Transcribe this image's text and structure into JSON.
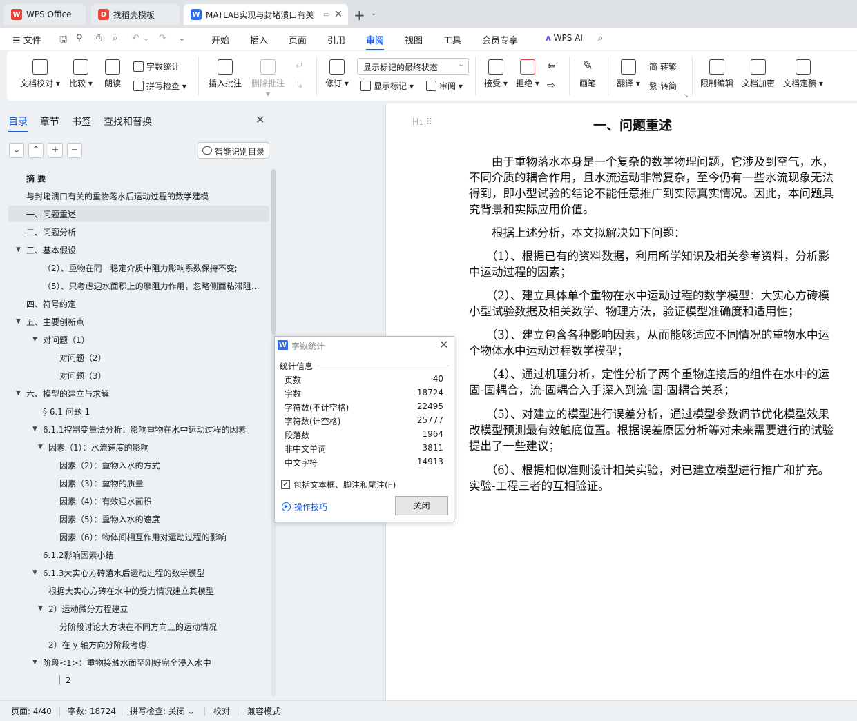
{
  "tabs": [
    {
      "label": "WPS Office",
      "logo": "W",
      "color": "#e8443a"
    },
    {
      "label": "找稻壳模板",
      "logo": "D",
      "color": "#e8443a"
    },
    {
      "label": "MATLAB实现与封堵溃口有关",
      "logo": "W",
      "color": "#2c6cf0"
    }
  ],
  "menu": {
    "file": "文件",
    "items": [
      "开始",
      "插入",
      "页面",
      "引用",
      "审阅",
      "视图",
      "工具",
      "会员专享"
    ],
    "active": "审阅",
    "wps_ai": "WPS AI"
  },
  "ribbon": {
    "doc_check": "文档校对",
    "compare": "比较",
    "read_aloud": "朗读",
    "word_count": "字数统计",
    "spell_check": "拼写检查",
    "insert_comment": "插入批注",
    "delete_comment": "删除批注",
    "revise": "修订",
    "markup_state": "显示标记的最终状态",
    "show_markup": "显示标记",
    "review": "审阅",
    "accept": "接受",
    "reject": "拒绝",
    "pen": "画笔",
    "translate": "翻译",
    "to_traditional": "转繁",
    "to_simplified": "转简",
    "restrict_edit": "限制编辑",
    "encrypt": "文档加密",
    "finalize": "文档定稿"
  },
  "nav": {
    "tabs": [
      "目录",
      "章节",
      "书签",
      "查找和替换"
    ],
    "active_tab": "目录",
    "smart_toc": "智能识别目录",
    "controls": [
      "⌄",
      "⌃",
      "+",
      "−"
    ],
    "items": [
      {
        "text": "摘  要",
        "indent": 0,
        "caret": "",
        "bold": true
      },
      {
        "text": "与封堵溃口有关的重物落水后运动过程的数学建模",
        "indent": 0,
        "caret": ""
      },
      {
        "text": "一、问题重述",
        "indent": 0,
        "caret": "",
        "selected": true
      },
      {
        "text": "二、问题分析",
        "indent": 0,
        "caret": ""
      },
      {
        "text": "三、基本假设",
        "indent": 0,
        "caret": "▼"
      },
      {
        "text": "（2）、重物在同一稳定介质中阻力影响系数保持不变;",
        "indent": 1,
        "caret": ""
      },
      {
        "text": "（5）、只考虑迎水面积上的摩阻力作用，忽略侧面粘滞阻力...",
        "indent": 1,
        "caret": ""
      },
      {
        "text": "四、符号约定",
        "indent": 0,
        "caret": ""
      },
      {
        "text": "五、主要创新点",
        "indent": 0,
        "caret": "▼"
      },
      {
        "text": "对问题（1）",
        "indent": 1,
        "caret": "▼"
      },
      {
        "text": "对问题（2）",
        "indent": 3,
        "caret": ""
      },
      {
        "text": "对问题（3）",
        "indent": 3,
        "caret": ""
      },
      {
        "text": "六、模型的建立与求解",
        "indent": 0,
        "caret": "▼"
      },
      {
        "text": "§ 6.1 问题 1",
        "indent": 1,
        "caret": ""
      },
      {
        "text": "6.1.1控制变量法分析：影响重物在水中运动过程的因素",
        "indent": 1,
        "caret": "▼"
      },
      {
        "text": "因素（1）：水流速度的影响",
        "indent": 2,
        "caret": "▼"
      },
      {
        "text": "因素（2）：重物入水的方式",
        "indent": 3,
        "caret": ""
      },
      {
        "text": "因素（3）：重物的质量",
        "indent": 3,
        "caret": ""
      },
      {
        "text": "因素（4）：有效迎水面积",
        "indent": 3,
        "caret": ""
      },
      {
        "text": "因素（5）：重物入水的速度",
        "indent": 3,
        "caret": ""
      },
      {
        "text": "因素（6）：物体间相互作用对运动过程的影响",
        "indent": 3,
        "caret": ""
      },
      {
        "text": "6.1.2影响因素小结",
        "indent": 1,
        "caret": ""
      },
      {
        "text": "6.1.3大实心方砖落水后运动过程的数学模型",
        "indent": 1,
        "caret": "▼"
      },
      {
        "text": "根据大实心方砖在水中的受力情况建立其模型",
        "indent": 2,
        "caret": ""
      },
      {
        "text": "2）运动微分方程建立",
        "indent": 2,
        "caret": "▼"
      },
      {
        "text": "分阶段讨论大方块在不同方向上的运动情况",
        "indent": 3,
        "caret": ""
      },
      {
        "text": "2）在 y 轴方向分阶段考虑:",
        "indent": 2,
        "caret": ""
      },
      {
        "text": "阶段<1>：重物接触水面至刚好完全浸入水中",
        "indent": 1,
        "caret": "▼"
      },
      {
        "text": "2",
        "indent": 3,
        "caret": "",
        "bar": true
      }
    ]
  },
  "document": {
    "heading_mark": "H",
    "title": "一、问题重述",
    "lines": [
      "　　由于重物落水本身是一个复杂的数学物理问题，它涉及到空气，水，",
      "不同介质的耦合作用，且水流运动非常复杂，至今仍有一些水流现象无法",
      "得到，即小型试验的结论不能任意推广到实际真实情况。因此，本问题具",
      "究背景和实际应用价值。",
      "　　根据上述分析，本文拟解决如下问题：",
      "　　（1）、根据已有的资料数据，利用所学知识及相关参考资料，分析影",
      "中运动过程的因素；",
      "　　（2）、建立具体单个重物在水中运动过程的数学模型：大实心方砖模",
      "小型试验数据及相关数学、物理方法，验证模型准确度和适用性；",
      "　　（3）、建立包含各种影响因素，从而能够适应不同情况的重物水中运",
      "个物体水中运动过程数学模型；",
      "　　（4）、通过机理分析，定性分析了两个重物连接后的组件在水中的运",
      "固-固耦合，流-固耦合入手深入到流-固-固耦合关系；",
      "　　（5）、对建立的模型进行误差分析，通过模型参数调节优化模型效果",
      "改模型预测最有效触底位置。根据误差原因分析等对未来需要进行的试验",
      "提出了一些建议；",
      "　　（6）、根据相似准则设计相关实验，对已建立模型进行推广和扩充。",
      "实验-工程三者的互相验证。"
    ]
  },
  "dialog": {
    "title": "字数统计",
    "section": "统计信息",
    "stats": [
      {
        "label": "页数",
        "value": "40"
      },
      {
        "label": "字数",
        "value": "18724"
      },
      {
        "label": "字符数(不计空格)",
        "value": "22495"
      },
      {
        "label": "字符数(计空格)",
        "value": "25777"
      },
      {
        "label": "段落数",
        "value": "1964"
      },
      {
        "label": "非中文单词",
        "value": "3811"
      },
      {
        "label": "中文字符",
        "value": "14913"
      }
    ],
    "checkbox": "包括文本框、脚注和尾注(F)",
    "checked": true,
    "tips": "操作技巧",
    "close": "关闭"
  },
  "status": {
    "page": "页面: 4/40",
    "words": "字数: 18724",
    "spell": "拼写检查: 关闭",
    "proof": "校对",
    "compat": "兼容模式"
  }
}
